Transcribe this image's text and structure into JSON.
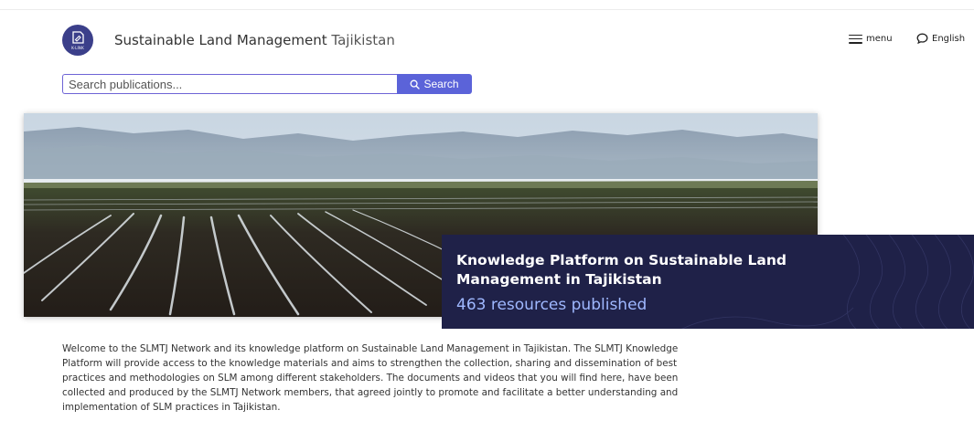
{
  "header": {
    "logo_text": "K-LINK",
    "title_main": "Sustainable Land Management",
    "title_sub": "Tajikistan",
    "menu_label": "menu",
    "language_label": "English",
    "icons": {
      "menu": "hamburger-icon",
      "language": "speech-bubble-icon",
      "search": "search-icon",
      "logo": "k-link-logo"
    }
  },
  "search": {
    "placeholder": "Search publications...",
    "button_label": "Search"
  },
  "hero": {
    "image_description_icon": "landscape-photo"
  },
  "card": {
    "title": "Knowledge Platform on Sustainable Land Management in Tajikistan",
    "count_text": "463 resources published"
  },
  "intro": {
    "text": "Welcome to the SLMTJ Network and its knowledge platform on Sustainable Land Management in Tajikistan. The SLMTJ Knowledge Platform will provide access to the knowledge materials and aims to strengthen the collection, sharing and dissemination of best practices and methodologies on SLM among different stakeholders. The documents and videos that you will find here, have been collected and produced by the SLMTJ Network members, that agreed jointly to promote and facilitate a better understanding and implementation of SLM practices in Tajikistan."
  },
  "colors": {
    "accent": "#5b63d9",
    "logo": "#3b3f8a",
    "card_bg": "#1f2148",
    "card_count": "#9fb8ff"
  }
}
